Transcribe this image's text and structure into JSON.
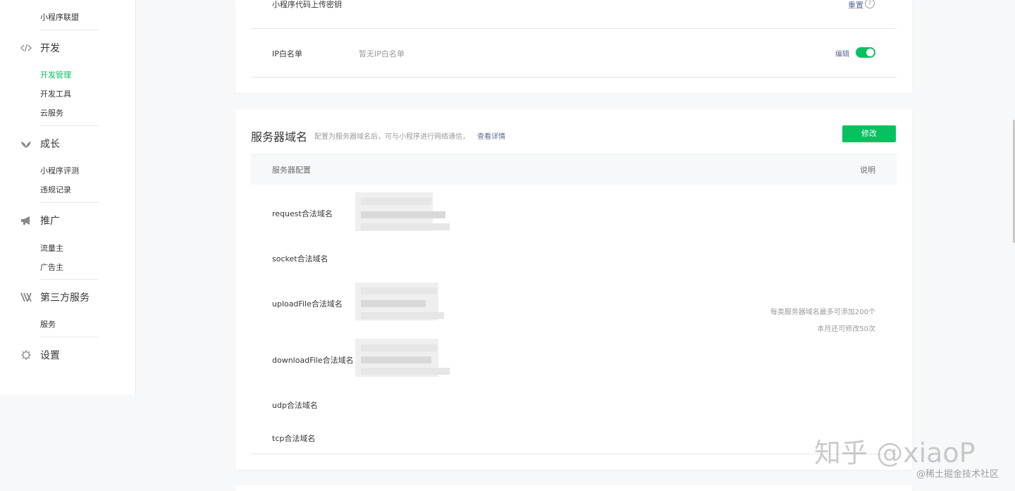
{
  "sidebar": {
    "top_partial_item": "小程序联盟",
    "groups": [
      {
        "icon": "code-icon",
        "label": "开发",
        "items": [
          "开发管理",
          "开发工具",
          "云服务"
        ]
      },
      {
        "icon": "leaf-icon",
        "label": "成长",
        "items": [
          "小程序评测",
          "违规记录"
        ]
      },
      {
        "icon": "megaphone-icon",
        "label": "推广",
        "items": [
          "流量主",
          "广告主"
        ]
      },
      {
        "icon": "third-party-icon",
        "label": "第三方服务",
        "items": [
          "服务"
        ]
      },
      {
        "icon": "gear-icon",
        "label": "设置",
        "items": []
      }
    ],
    "active_item": "开发管理"
  },
  "top_card": {
    "upload_key_label": "小程序代码上传密钥",
    "reset_link": "重置",
    "help_glyph": "?",
    "ip_whitelist_label": "IP白名单",
    "ip_whitelist_value": "暂无IP白名单",
    "edit_link": "编辑",
    "toggle_on": true
  },
  "server_domain": {
    "title": "服务器域名",
    "description": "配置为服务器域名后，可与小程序进行网络通信，",
    "details_link": "查看详情",
    "modify_button": "修改",
    "table_headers": {
      "config": "服务器配置",
      "note": "说明"
    },
    "rows": [
      {
        "label": "request合法域名"
      },
      {
        "label": "socket合法域名"
      },
      {
        "label": "uploadFile合法域名"
      },
      {
        "label": "downloadFile合法域名"
      },
      {
        "label": "udp合法域名"
      },
      {
        "label": "tcp合法域名"
      }
    ],
    "notes": [
      "每类服务器域名最多可添加200个",
      "本月还可修改50次"
    ]
  },
  "watermark": {
    "main": "知乎 @xiaoP",
    "sub": "@稀土掘金技术社区"
  },
  "colors": {
    "accent": "#07c160",
    "link": "#576b95"
  }
}
